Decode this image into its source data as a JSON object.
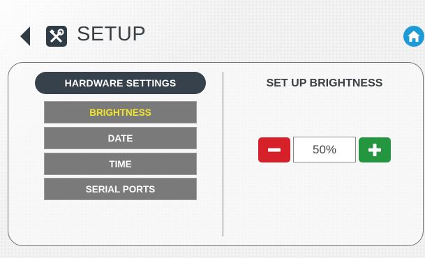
{
  "header": {
    "title": "SETUP",
    "back_icon": "back-arrow-icon",
    "setup_icon": "tools-icon",
    "home_icon": "home-icon"
  },
  "sidebar": {
    "group_label": "HARDWARE SETTINGS",
    "items": [
      {
        "label": "BRIGHTNESS",
        "active": true
      },
      {
        "label": "DATE",
        "active": false
      },
      {
        "label": "TIME",
        "active": false
      },
      {
        "label": "SERIAL PORTS",
        "active": false
      }
    ]
  },
  "brightness": {
    "title": "SET UP BRIGHTNESS",
    "value": "50%",
    "decrease_icon": "minus-icon",
    "increase_icon": "plus-icon"
  },
  "colors": {
    "active_item_text": "#f3e62c",
    "decrease": "#d6212a",
    "increase": "#23963f",
    "home": "#1e9bd7",
    "dark": "#36414b"
  }
}
